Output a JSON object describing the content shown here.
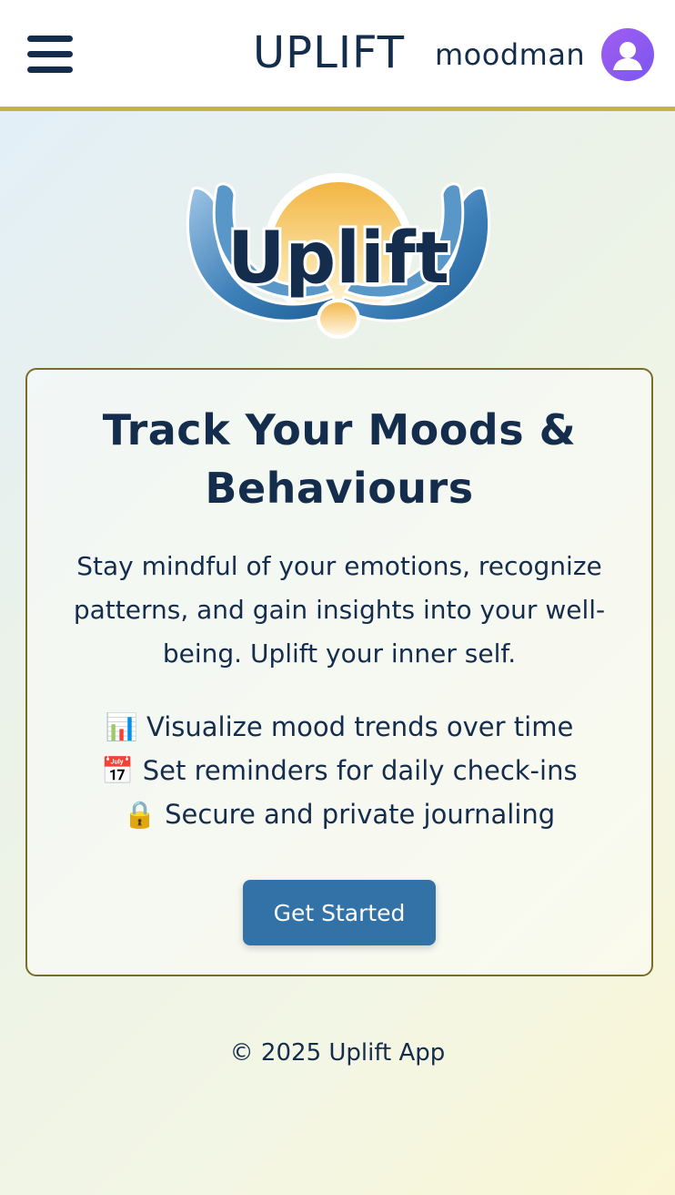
{
  "header": {
    "brand": "UPLIFT",
    "username": "moodman",
    "icons": {
      "menu": "hamburger-menu-icon",
      "avatar": "user-avatar-icon"
    }
  },
  "logo": {
    "text": "Uplift"
  },
  "card": {
    "title": "Track Your Moods & Behaviours",
    "description": "Stay mindful of your emotions, recognize patterns, and gain insights into your well-being. Uplift your inner self.",
    "features": [
      "📊 Visualize mood trends over time",
      "📅 Set reminders for daily check-ins",
      "🔒 Secure and private journaling"
    ],
    "cta_label": "Get Started"
  },
  "footer": {
    "text": "© 2025 Uplift App"
  },
  "colors": {
    "primary_text": "#142d4c",
    "accent_bar": "#c2b540",
    "cta": "#3272a6",
    "avatar": "#8b5cf6"
  }
}
